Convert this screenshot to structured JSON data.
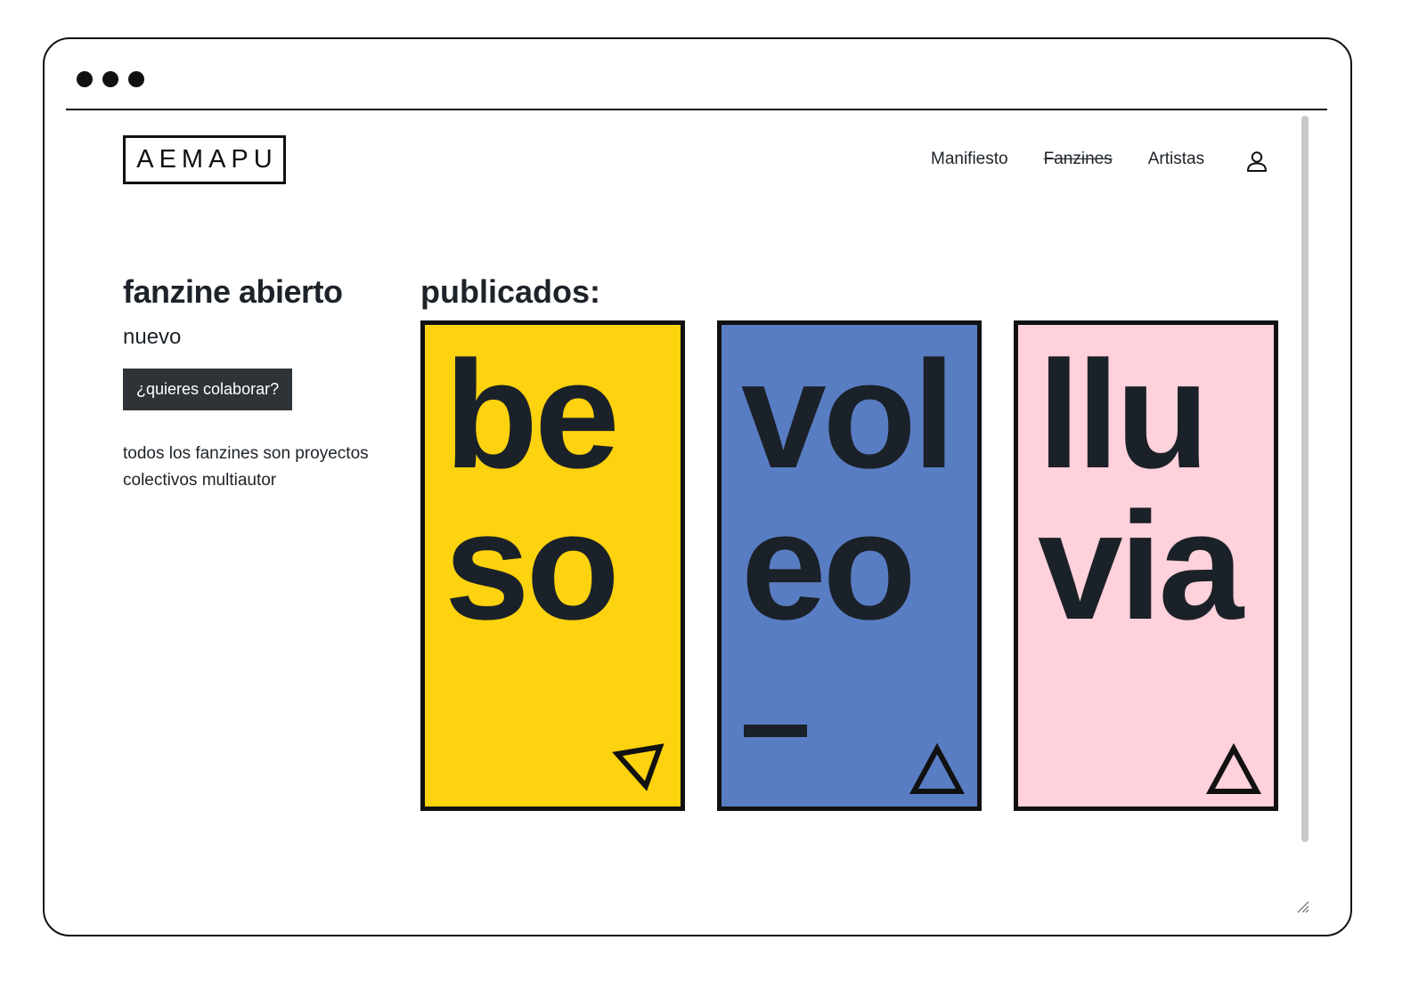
{
  "browser": {
    "window_controls": [
      "dot",
      "dot",
      "dot"
    ]
  },
  "header": {
    "logo_text": "AEMAPU",
    "nav": [
      {
        "label": "Manifiesto",
        "struck": false
      },
      {
        "label": "Fanzines",
        "struck": true
      },
      {
        "label": "Artistas",
        "struck": false
      }
    ],
    "user_icon": "user-icon"
  },
  "sidebar": {
    "title": "fanzine abierto",
    "subtitle": "nuevo",
    "cta_label": "¿quieres colaborar?",
    "description": "todos los fanzines son proyectos colectivos multiautor"
  },
  "published": {
    "title": "publicados:",
    "cards": [
      {
        "line1": "be",
        "line2": "so",
        "color": "#fdd20e",
        "icon": "triangle-right-icon",
        "has_dash": false
      },
      {
        "line1": "vol",
        "line2": "eo",
        "color": "#597dc3",
        "icon": "triangle-up-icon",
        "has_dash": true
      },
      {
        "line1": "llu",
        "line2": "via",
        "color": "#ffd1da",
        "icon": "triangle-up-icon",
        "has_dash": false
      }
    ]
  }
}
